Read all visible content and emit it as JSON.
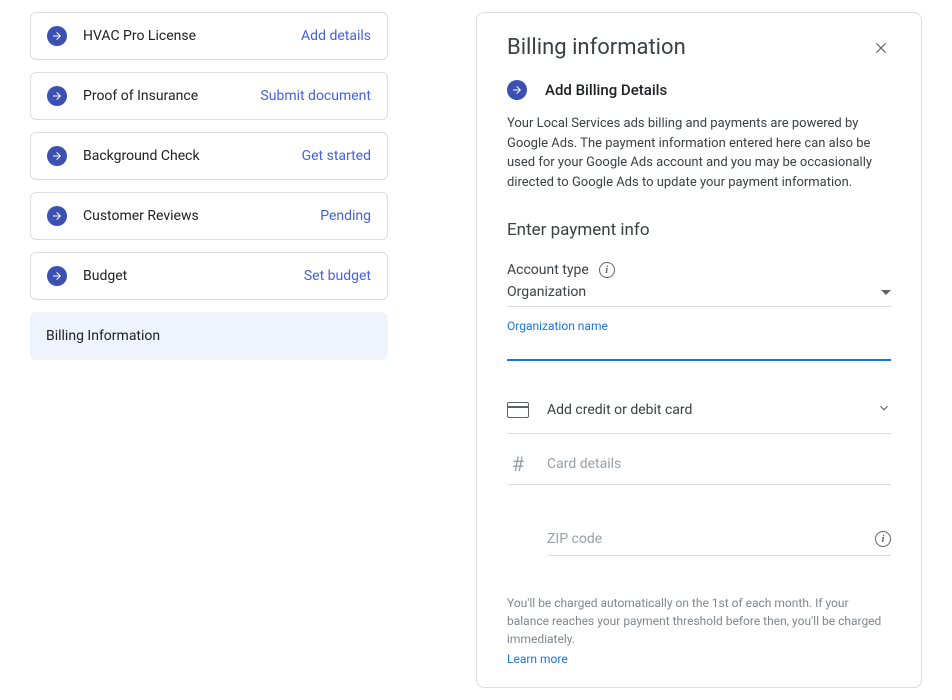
{
  "steps": [
    {
      "label": "HVAC Pro License",
      "action": "Add details"
    },
    {
      "label": "Proof of Insurance",
      "action": "Submit document"
    },
    {
      "label": "Background Check",
      "action": "Get started"
    },
    {
      "label": "Customer Reviews",
      "action": "Pending"
    },
    {
      "label": "Budget",
      "action": "Set budget"
    }
  ],
  "active_step_label": "Billing Information",
  "panel": {
    "title": "Billing information",
    "subheader": "Add Billing Details",
    "body": "Your Local Services ads billing and payments are powered by Google Ads. The payment information entered here can also be used for your Google Ads account and you may be occasionally directed to Google Ads to update your payment information.",
    "section_title": "Enter payment info",
    "account_type_label": "Account type",
    "account_type_value": "Organization",
    "org_name_label": "Organization name",
    "add_card_label": "Add credit or debit card",
    "card_details_placeholder": "Card details",
    "zip_placeholder": "ZIP code",
    "footnote": "You'll be charged automatically on the 1st of each month. If your balance reaches your payment threshold before then, you'll be charged immediately.",
    "learn_more": "Learn more"
  }
}
